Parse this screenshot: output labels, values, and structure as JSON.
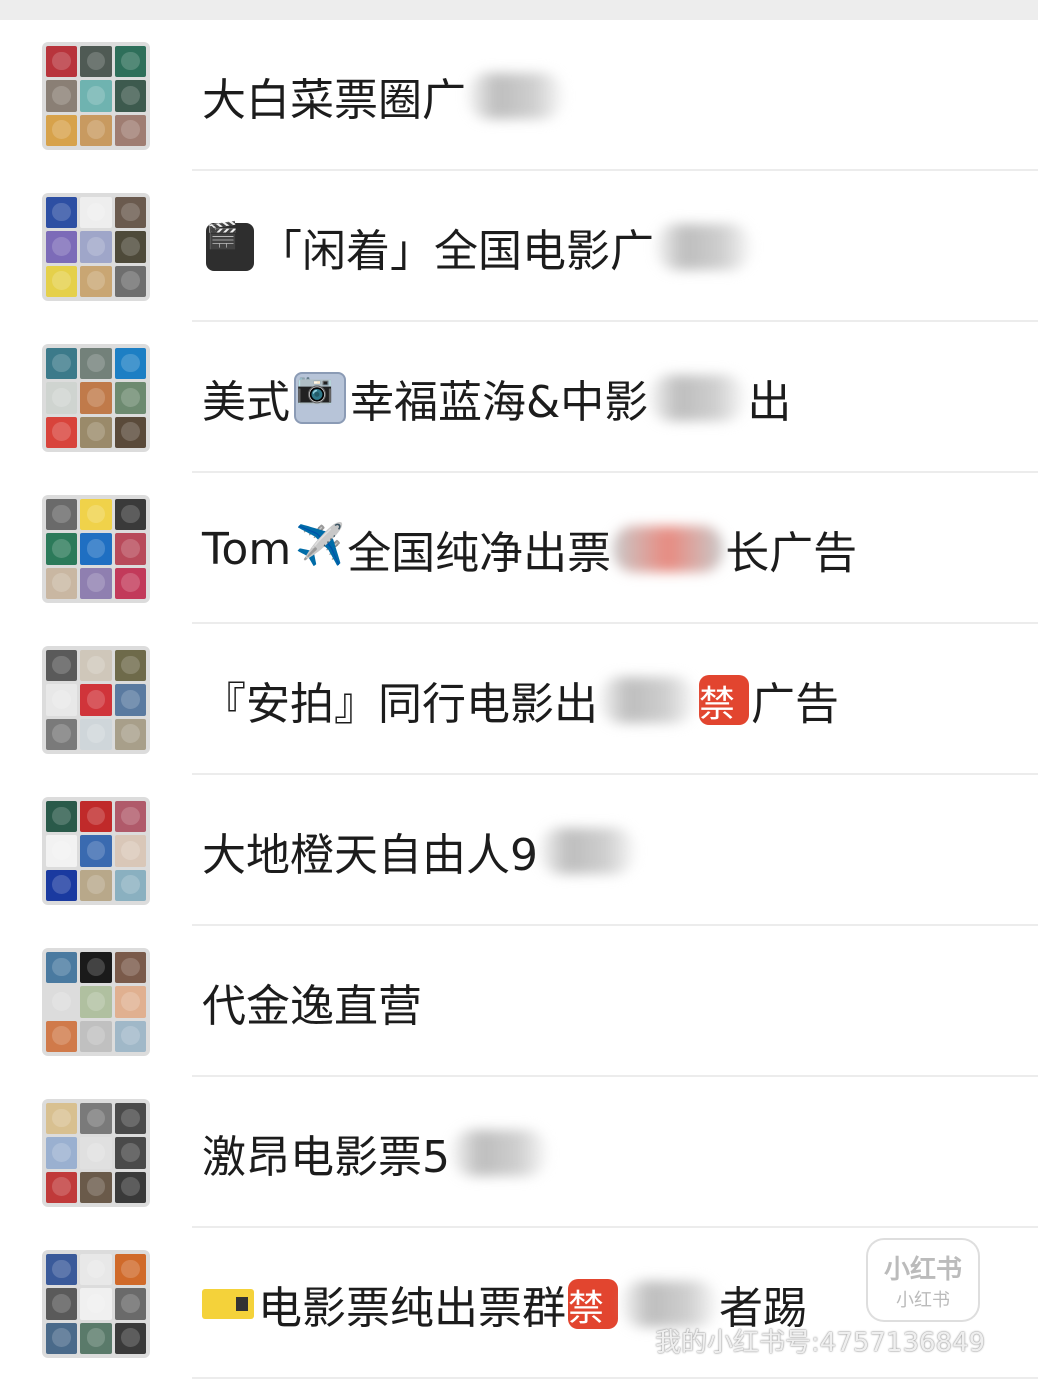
{
  "chats": [
    {
      "parts": [
        "大白菜票圈广",
        "##blur"
      ],
      "tiles": [
        "#b8343c",
        "#4f5a54",
        "#2e6f5a",
        "#8a7f75",
        "#6fb3b0",
        "#3d5a4e",
        "#d7a24b",
        "#c89a60",
        "#9f7d72"
      ]
    },
    {
      "parts": [
        "##clapper",
        "「闲着」全国电影广",
        "##blur"
      ],
      "tiles": [
        "#2d4fa3",
        "#eeeeee",
        "#6a5a4e",
        "#7c6bb8",
        "#9fa6c9",
        "#4e4a3a",
        "#e5d04a",
        "#c9a673",
        "#6e6e6e"
      ]
    },
    {
      "parts": [
        "美式",
        "##camera",
        "幸福蓝海&中影",
        "##blur",
        "出"
      ],
      "tiles": [
        "#3c7a8a",
        "#73817a",
        "#1d7fc4",
        "#cfd4d0",
        "#c07a4a",
        "#6d8a70",
        "#d8433b",
        "#9a8a6a",
        "#5a4a3a"
      ]
    },
    {
      "parts": [
        "Tom",
        "##plane",
        "全国纯净出票",
        "##blurred",
        "长广告"
      ],
      "tiles": [
        "#6a6a6a",
        "#f0d24a",
        "#3a3a3a",
        "#2c7a5a",
        "#1f6fc2",
        "#b84a5a",
        "#c9b7a2",
        "#8f7fb0",
        "#c23a5a"
      ]
    },
    {
      "parts": [
        "『安拍』同行电影出",
        "##blur",
        "##ban",
        "广告"
      ],
      "tiles": [
        "#5a5a5a",
        "#cfc7ba",
        "#6e6a4a",
        "#e8e8e8",
        "#d0343a",
        "#5a7aa0",
        "#7a7a7a",
        "#cfd6da",
        "#a89f8a"
      ]
    },
    {
      "parts": [
        "大地橙天自由人9",
        "##blur"
      ],
      "tiles": [
        "#2a5a4a",
        "#c02a2a",
        "#b05a6a",
        "#f2f2f2",
        "#3a6ab0",
        "#d9c7b8",
        "#1a3aa0",
        "#b8a88a",
        "#8ab0c0"
      ]
    },
    {
      "parts": [
        "代金逸直营"
      ],
      "tiles": [
        "#4a7aa0",
        "#1a1a1a",
        "#7a5a4a",
        "#dcdcdc",
        "#b0c0a0",
        "#e0b090",
        "#d07a4a",
        "#c0c0c0",
        "#a0b8c8"
      ]
    },
    {
      "parts": [
        "激昂电影票5",
        "##blur"
      ],
      "tiles": [
        "#d8c090",
        "#7a7a7a",
        "#4a4a4a",
        "#9ab0d0",
        "#e0e0e0",
        "#4a4a4a",
        "#c03a3a",
        "#6a5a4a",
        "#3a3a3a"
      ]
    },
    {
      "parts": [
        "##ticket",
        "电影票纯出票群",
        "##ban",
        "##blur",
        "者踢"
      ],
      "tiles": [
        "#3a5a9a",
        "#e8e8e8",
        "#d06a2a",
        "#5a5a5a",
        "#f0f0f0",
        "#6a6a6a",
        "#4a6a8a",
        "#5a7a6a",
        "#3a3a3a"
      ]
    }
  ],
  "icons": {
    "clapper": "🎬",
    "camera": "📷",
    "plane": "✈️",
    "ban": "禁"
  },
  "watermark": {
    "text": "我的小红书号:4757136849",
    "logo_main": "小红书",
    "logo_sub": "小红书"
  }
}
